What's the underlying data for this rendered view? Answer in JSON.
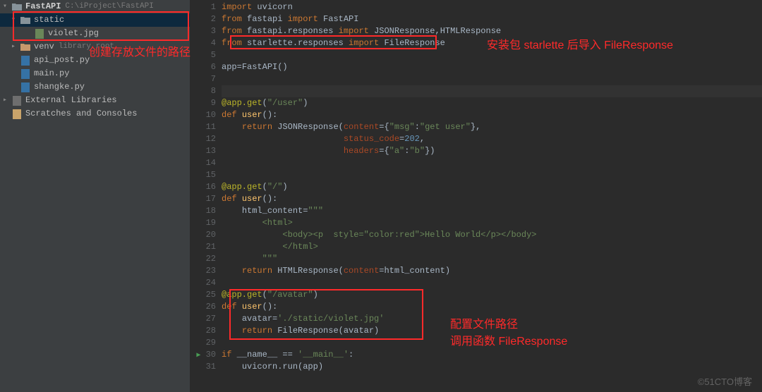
{
  "sidebar": {
    "project": {
      "name": "FastAPI",
      "path": "C:\\iProject\\FastAPI"
    },
    "items": [
      {
        "kind": "folder",
        "label": "static",
        "indent": 1,
        "expanded": true,
        "selected": true,
        "colored": false
      },
      {
        "kind": "file",
        "label": "violet.jpg",
        "indent": 2
      },
      {
        "kind": "folder",
        "label": "venv",
        "indent": 1,
        "expanded": false,
        "hint": "library root",
        "colored": true
      },
      {
        "kind": "pyfile",
        "label": "api_post.py",
        "indent": 1
      },
      {
        "kind": "pyfile",
        "label": "main.py",
        "indent": 1
      },
      {
        "kind": "pyfile",
        "label": "shangke.py",
        "indent": 1
      }
    ],
    "lib_label": "External Libraries",
    "scratch_label": "Scratches and Consoles"
  },
  "code": {
    "lines": [
      [
        {
          "c": "kw",
          "t": "import "
        },
        {
          "c": "ident",
          "t": "uvicorn"
        }
      ],
      [
        {
          "c": "kw",
          "t": "from "
        },
        {
          "c": "ident",
          "t": "fastapi "
        },
        {
          "c": "kw",
          "t": "import "
        },
        {
          "c": "ident",
          "t": "FastAPI"
        }
      ],
      [
        {
          "c": "kw",
          "t": "from "
        },
        {
          "c": "ident",
          "t": "fastapi.responses "
        },
        {
          "c": "kw",
          "t": "import "
        },
        {
          "c": "ident",
          "t": "JSONResponse"
        },
        {
          "c": "op",
          "t": ","
        },
        {
          "c": "ident",
          "t": "HTMLResponse"
        }
      ],
      [
        {
          "c": "kw",
          "t": "from "
        },
        {
          "c": "ident",
          "t": "starlette.responses "
        },
        {
          "c": "kw",
          "t": "import "
        },
        {
          "c": "ident",
          "t": "FileResponse"
        }
      ],
      [],
      [
        {
          "c": "ident",
          "t": "app"
        },
        {
          "c": "op",
          "t": "="
        },
        {
          "c": "ident",
          "t": "FastAPI()"
        }
      ],
      [],
      [],
      [
        {
          "c": "dec",
          "t": "@app.get"
        },
        {
          "c": "op",
          "t": "("
        },
        {
          "c": "str",
          "t": "\"/user\""
        },
        {
          "c": "op",
          "t": ")"
        }
      ],
      [
        {
          "c": "kw",
          "t": "def "
        },
        {
          "c": "fn",
          "t": "user"
        },
        {
          "c": "op",
          "t": "():"
        }
      ],
      [
        {
          "c": "op",
          "t": "    "
        },
        {
          "c": "kw",
          "t": "return "
        },
        {
          "c": "ident",
          "t": "JSONResponse("
        },
        {
          "c": "param",
          "t": "content"
        },
        {
          "c": "op",
          "t": "={"
        },
        {
          "c": "str",
          "t": "\"msg\""
        },
        {
          "c": "op",
          "t": ":"
        },
        {
          "c": "str",
          "t": "\"get user\""
        },
        {
          "c": "op",
          "t": "},"
        }
      ],
      [
        {
          "c": "op",
          "t": "                        "
        },
        {
          "c": "param",
          "t": "status_code"
        },
        {
          "c": "op",
          "t": "="
        },
        {
          "c": "num",
          "t": "202"
        },
        {
          "c": "op",
          "t": ","
        }
      ],
      [
        {
          "c": "op",
          "t": "                        "
        },
        {
          "c": "param",
          "t": "headers"
        },
        {
          "c": "op",
          "t": "={"
        },
        {
          "c": "str",
          "t": "\"a\""
        },
        {
          "c": "op",
          "t": ":"
        },
        {
          "c": "str",
          "t": "\"b\""
        },
        {
          "c": "op",
          "t": "})"
        }
      ],
      [],
      [],
      [
        {
          "c": "dec",
          "t": "@app.get"
        },
        {
          "c": "op",
          "t": "("
        },
        {
          "c": "str",
          "t": "\"/\""
        },
        {
          "c": "op",
          "t": ")"
        }
      ],
      [
        {
          "c": "kw",
          "t": "def "
        },
        {
          "c": "fn",
          "t": "user"
        },
        {
          "c": "op",
          "t": "():"
        }
      ],
      [
        {
          "c": "op",
          "t": "    "
        },
        {
          "c": "ident",
          "t": "html_content"
        },
        {
          "c": "op",
          "t": "="
        },
        {
          "c": "str",
          "t": "\"\"\""
        }
      ],
      [
        {
          "c": "str",
          "t": "        <html>"
        }
      ],
      [
        {
          "c": "str",
          "t": "            <body><p  style=\"color:red\">Hello World</p></body>"
        }
      ],
      [
        {
          "c": "str",
          "t": "            </html>"
        }
      ],
      [
        {
          "c": "str",
          "t": "        \"\"\""
        }
      ],
      [
        {
          "c": "op",
          "t": "    "
        },
        {
          "c": "kw",
          "t": "return "
        },
        {
          "c": "ident",
          "t": "HTMLResponse("
        },
        {
          "c": "param",
          "t": "content"
        },
        {
          "c": "op",
          "t": "=html_content)"
        }
      ],
      [],
      [
        {
          "c": "dec",
          "t": "@app.get"
        },
        {
          "c": "op",
          "t": "("
        },
        {
          "c": "str",
          "t": "\"/avatar\""
        },
        {
          "c": "op",
          "t": ")"
        }
      ],
      [
        {
          "c": "kw",
          "t": "def "
        },
        {
          "c": "fn",
          "t": "user"
        },
        {
          "c": "op",
          "t": "():"
        }
      ],
      [
        {
          "c": "op",
          "t": "    "
        },
        {
          "c": "ident",
          "t": "avatar"
        },
        {
          "c": "op",
          "t": "="
        },
        {
          "c": "str",
          "t": "'./static/violet.jpg'"
        }
      ],
      [
        {
          "c": "op",
          "t": "    "
        },
        {
          "c": "kw",
          "t": "return "
        },
        {
          "c": "ident",
          "t": "FileResponse(avatar)"
        }
      ],
      [],
      [
        {
          "c": "kw",
          "t": "if "
        },
        {
          "c": "ident",
          "t": "__name__ "
        },
        {
          "c": "op",
          "t": "== "
        },
        {
          "c": "str",
          "t": "'__main__'"
        },
        {
          "c": "op",
          "t": ":"
        }
      ],
      [
        {
          "c": "op",
          "t": "    "
        },
        {
          "c": "ident",
          "t": "uvicorn.run("
        },
        {
          "c": "ident",
          "t": "app"
        },
        {
          "c": "op",
          "t": ")"
        }
      ]
    ]
  },
  "annotations": {
    "a1_text": "创建存放文件的路径",
    "a2_text": "安装包 starlette 后导入 FileResponse",
    "a3_line1": "配置文件路径",
    "a3_line2": "调用函数 FileResponse"
  },
  "watermark": "©51CTO博客"
}
